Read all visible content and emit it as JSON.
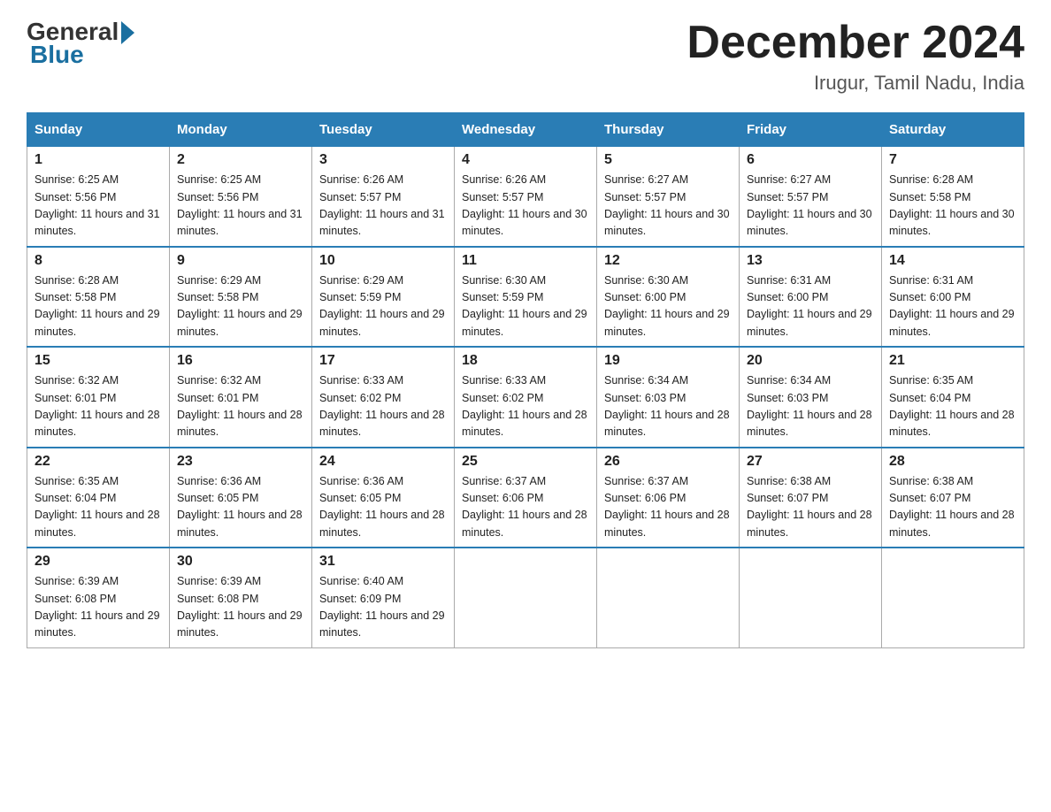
{
  "header": {
    "logo_general": "General",
    "logo_blue": "Blue",
    "month_title": "December 2024",
    "location": "Irugur, Tamil Nadu, India"
  },
  "days_of_week": [
    "Sunday",
    "Monday",
    "Tuesday",
    "Wednesday",
    "Thursday",
    "Friday",
    "Saturday"
  ],
  "weeks": [
    [
      {
        "day": "1",
        "sunrise": "6:25 AM",
        "sunset": "5:56 PM",
        "daylight": "11 hours and 31 minutes."
      },
      {
        "day": "2",
        "sunrise": "6:25 AM",
        "sunset": "5:56 PM",
        "daylight": "11 hours and 31 minutes."
      },
      {
        "day": "3",
        "sunrise": "6:26 AM",
        "sunset": "5:57 PM",
        "daylight": "11 hours and 31 minutes."
      },
      {
        "day": "4",
        "sunrise": "6:26 AM",
        "sunset": "5:57 PM",
        "daylight": "11 hours and 30 minutes."
      },
      {
        "day": "5",
        "sunrise": "6:27 AM",
        "sunset": "5:57 PM",
        "daylight": "11 hours and 30 minutes."
      },
      {
        "day": "6",
        "sunrise": "6:27 AM",
        "sunset": "5:57 PM",
        "daylight": "11 hours and 30 minutes."
      },
      {
        "day": "7",
        "sunrise": "6:28 AM",
        "sunset": "5:58 PM",
        "daylight": "11 hours and 30 minutes."
      }
    ],
    [
      {
        "day": "8",
        "sunrise": "6:28 AM",
        "sunset": "5:58 PM",
        "daylight": "11 hours and 29 minutes."
      },
      {
        "day": "9",
        "sunrise": "6:29 AM",
        "sunset": "5:58 PM",
        "daylight": "11 hours and 29 minutes."
      },
      {
        "day": "10",
        "sunrise": "6:29 AM",
        "sunset": "5:59 PM",
        "daylight": "11 hours and 29 minutes."
      },
      {
        "day": "11",
        "sunrise": "6:30 AM",
        "sunset": "5:59 PM",
        "daylight": "11 hours and 29 minutes."
      },
      {
        "day": "12",
        "sunrise": "6:30 AM",
        "sunset": "6:00 PM",
        "daylight": "11 hours and 29 minutes."
      },
      {
        "day": "13",
        "sunrise": "6:31 AM",
        "sunset": "6:00 PM",
        "daylight": "11 hours and 29 minutes."
      },
      {
        "day": "14",
        "sunrise": "6:31 AM",
        "sunset": "6:00 PM",
        "daylight": "11 hours and 29 minutes."
      }
    ],
    [
      {
        "day": "15",
        "sunrise": "6:32 AM",
        "sunset": "6:01 PM",
        "daylight": "11 hours and 28 minutes."
      },
      {
        "day": "16",
        "sunrise": "6:32 AM",
        "sunset": "6:01 PM",
        "daylight": "11 hours and 28 minutes."
      },
      {
        "day": "17",
        "sunrise": "6:33 AM",
        "sunset": "6:02 PM",
        "daylight": "11 hours and 28 minutes."
      },
      {
        "day": "18",
        "sunrise": "6:33 AM",
        "sunset": "6:02 PM",
        "daylight": "11 hours and 28 minutes."
      },
      {
        "day": "19",
        "sunrise": "6:34 AM",
        "sunset": "6:03 PM",
        "daylight": "11 hours and 28 minutes."
      },
      {
        "day": "20",
        "sunrise": "6:34 AM",
        "sunset": "6:03 PM",
        "daylight": "11 hours and 28 minutes."
      },
      {
        "day": "21",
        "sunrise": "6:35 AM",
        "sunset": "6:04 PM",
        "daylight": "11 hours and 28 minutes."
      }
    ],
    [
      {
        "day": "22",
        "sunrise": "6:35 AM",
        "sunset": "6:04 PM",
        "daylight": "11 hours and 28 minutes."
      },
      {
        "day": "23",
        "sunrise": "6:36 AM",
        "sunset": "6:05 PM",
        "daylight": "11 hours and 28 minutes."
      },
      {
        "day": "24",
        "sunrise": "6:36 AM",
        "sunset": "6:05 PM",
        "daylight": "11 hours and 28 minutes."
      },
      {
        "day": "25",
        "sunrise": "6:37 AM",
        "sunset": "6:06 PM",
        "daylight": "11 hours and 28 minutes."
      },
      {
        "day": "26",
        "sunrise": "6:37 AM",
        "sunset": "6:06 PM",
        "daylight": "11 hours and 28 minutes."
      },
      {
        "day": "27",
        "sunrise": "6:38 AM",
        "sunset": "6:07 PM",
        "daylight": "11 hours and 28 minutes."
      },
      {
        "day": "28",
        "sunrise": "6:38 AM",
        "sunset": "6:07 PM",
        "daylight": "11 hours and 28 minutes."
      }
    ],
    [
      {
        "day": "29",
        "sunrise": "6:39 AM",
        "sunset": "6:08 PM",
        "daylight": "11 hours and 29 minutes."
      },
      {
        "day": "30",
        "sunrise": "6:39 AM",
        "sunset": "6:08 PM",
        "daylight": "11 hours and 29 minutes."
      },
      {
        "day": "31",
        "sunrise": "6:40 AM",
        "sunset": "6:09 PM",
        "daylight": "11 hours and 29 minutes."
      },
      null,
      null,
      null,
      null
    ]
  ]
}
